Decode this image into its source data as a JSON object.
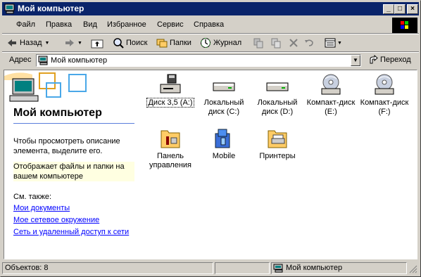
{
  "window": {
    "title": "Мой компьютер"
  },
  "menubar": [
    {
      "label": "Файл"
    },
    {
      "label": "Правка"
    },
    {
      "label": "Вид"
    },
    {
      "label": "Избранное"
    },
    {
      "label": "Сервис"
    },
    {
      "label": "Справка"
    }
  ],
  "toolbar": {
    "back": "Назад",
    "search": "Поиск",
    "folders": "Папки",
    "history": "Журнал"
  },
  "address": {
    "label": "Адрес",
    "value": "Мой компьютер",
    "go": "Переход"
  },
  "leftpane": {
    "title": "Мой компьютер",
    "hint": "Чтобы просмотреть описание элемента, выделите его.",
    "note": "Отображает файлы и папки на вашем компьютере",
    "see_also": "См. также:",
    "links": [
      "Мои документы",
      "Мое сетевое окружение",
      "Сеть и удаленный доступ к сети"
    ]
  },
  "items": [
    {
      "label": "Диск 3,5 (A:)",
      "icon": "floppy-drive-icon"
    },
    {
      "label": "Локальный диск (C:)",
      "icon": "hard-drive-icon"
    },
    {
      "label": "Локальный диск (D:)",
      "icon": "hard-drive-icon"
    },
    {
      "label": "Компакт-диск (E:)",
      "icon": "cd-drive-icon"
    },
    {
      "label": "Компакт-диск (F:)",
      "icon": "cd-drive-icon"
    },
    {
      "label": "Панель управления",
      "icon": "control-panel-icon"
    },
    {
      "label": "Mobile",
      "icon": "mobile-folder-icon"
    },
    {
      "label": "Принтеры",
      "icon": "printers-folder-icon"
    }
  ],
  "status": {
    "count": "Объектов: 8",
    "location": "Мой компьютер"
  },
  "colors": {
    "titlebar": "#0a246a",
    "link": "#0000ff",
    "face": "#d4d0c8"
  }
}
